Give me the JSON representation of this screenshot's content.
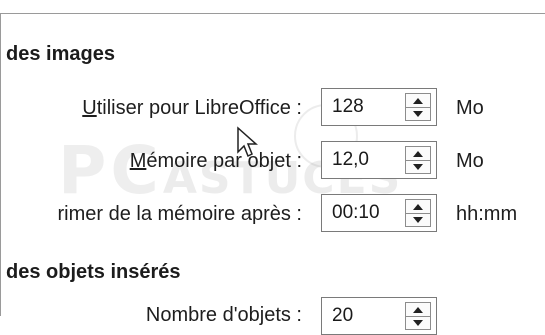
{
  "sections": {
    "images_title": "des images",
    "objects_title": "des objets insérés"
  },
  "rows": [
    {
      "label_underline": "U",
      "label_rest": "tiliser pour LibreOffice :",
      "value": "128",
      "unit": "Mo"
    },
    {
      "label_underline": "M",
      "label_rest": "émoire par objet :",
      "value": "12,0",
      "unit": "Mo"
    },
    {
      "label_underline": "",
      "label_rest": "rimer de la mémoire après :",
      "value": "00:10",
      "unit": "hh:mm"
    },
    {
      "label_underline": "",
      "label_rest": "Nombre d'objets :",
      "value": "20",
      "unit": ""
    }
  ],
  "watermark": {
    "text_main": "PC",
    "text_small": "ASTUCES"
  },
  "colors": {
    "text": "#1e1e1e",
    "border": "#7a7a7a",
    "background": "#ffffff"
  },
  "icons": [
    "spin-up-icon",
    "spin-down-icon",
    "mouse-cursor-icon"
  ]
}
